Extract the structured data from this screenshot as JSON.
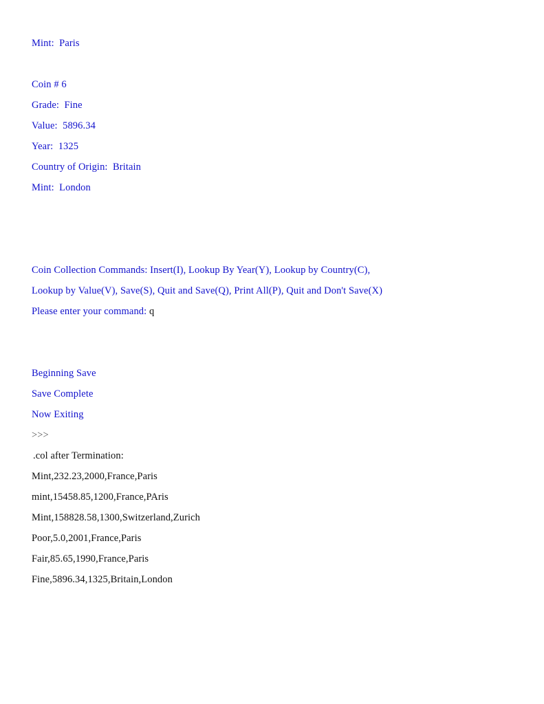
{
  "theme": {
    "background": "#ffffff",
    "output_text_color": "#1111cc",
    "user_text_color": "#111111",
    "prompt_symbol_color": "#555555"
  },
  "console": {
    "coin_record_tail": {
      "mint_label": "Mint:  Paris"
    },
    "coin_record": {
      "header": "Coin # 6",
      "grade": "Grade:  Fine",
      "value": "Value:  5896.34",
      "year": "Year:  1325",
      "country": "Country of Origin:  Britain",
      "mint": "Mint:  London"
    },
    "menu": {
      "line1": "Coin Collection Commands: Insert(I), Lookup By Year(Y), Lookup by Country(C),",
      "line2": "Lookup by Value(V), Save(S), Quit and Save(Q), Print All(P), Quit and Don't Save(X)"
    },
    "prompt": {
      "label": "Please enter your command:",
      "entered_command": "q"
    },
    "save_messages": {
      "beginning": "Beginning Save",
      "complete": "Save Complete",
      "exiting": "Now Exiting"
    },
    "interpreter_prompt": ">>>",
    "file_dump": {
      "header": ".col after Termination:",
      "rows": [
        "Mint,232.23,2000,France,Paris",
        "mint,15458.85,1200,France,PAris",
        "Mint,158828.58,1300,Switzerland,Zurich",
        "Poor,5.0,2001,France,Paris",
        "Fair,85.65,1990,France,Paris",
        "Fine,5896.34,1325,Britain,London"
      ]
    }
  }
}
